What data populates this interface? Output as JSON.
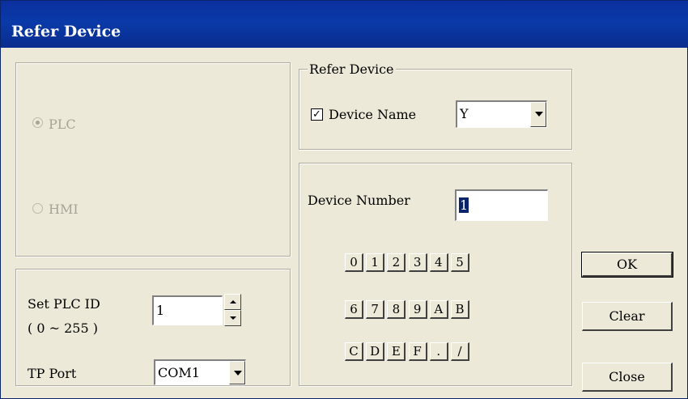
{
  "window": {
    "title": "Refer Device"
  },
  "target": {
    "plc_label": "PLC",
    "hmi_label": "HMI",
    "plc_selected": true
  },
  "plc_settings": {
    "plc_id_label": "Set PLC ID",
    "plc_id_range": "( 0 ~ 255 )",
    "plc_id_value": "1",
    "tp_port_label": "TP Port",
    "tp_port_value": "COM1"
  },
  "refer_device": {
    "group_title": "Refer Device",
    "device_name_label": "Device Name",
    "device_name_checked": true,
    "device_name_value": "Y"
  },
  "device_number": {
    "label": "Device Number",
    "value": "1",
    "keypad": [
      "0",
      "1",
      "2",
      "3",
      "4",
      "5",
      "6",
      "7",
      "8",
      "9",
      "A",
      "B",
      "C",
      "D",
      "E",
      "F",
      ".",
      "/"
    ]
  },
  "buttons": {
    "ok": "OK",
    "clear": "Clear",
    "close": "Close"
  }
}
